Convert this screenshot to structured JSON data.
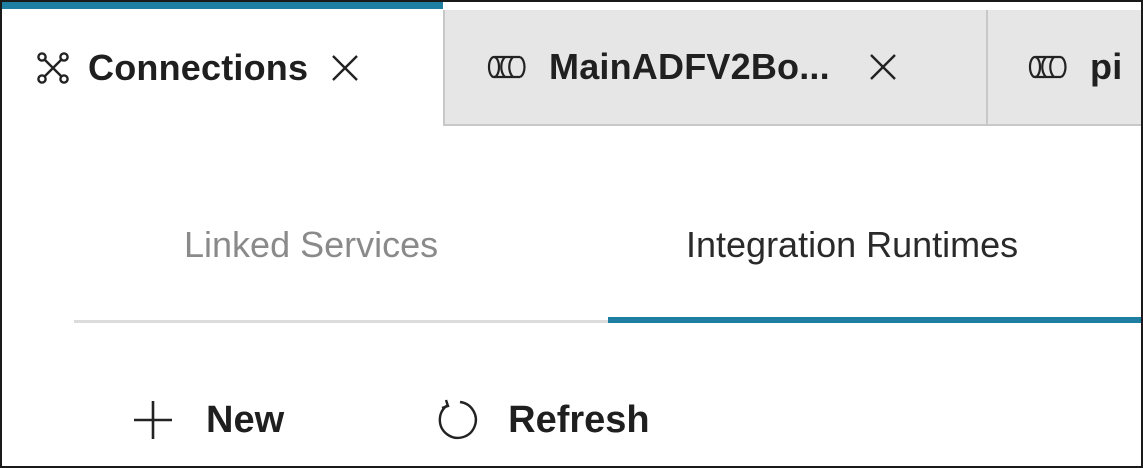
{
  "tabs": [
    {
      "label": "Connections",
      "icon": "connections-icon",
      "active": true,
      "closable": true
    },
    {
      "label": "MainADFV2Bo...",
      "icon": "pipeline-icon",
      "active": false,
      "closable": true
    },
    {
      "label": "pi",
      "icon": "pipeline-icon",
      "active": false,
      "closable": false
    }
  ],
  "subtabs": {
    "linked_services": "Linked Services",
    "integration_runtimes": "Integration Runtimes",
    "selected": "Integration Runtimes"
  },
  "toolbar": {
    "new_label": "New",
    "refresh_label": "Refresh"
  },
  "colors": {
    "accent": "#1f7fa3",
    "inactive_tab_bg": "#e6e6e6",
    "muted_text": "#8a8a8a"
  }
}
